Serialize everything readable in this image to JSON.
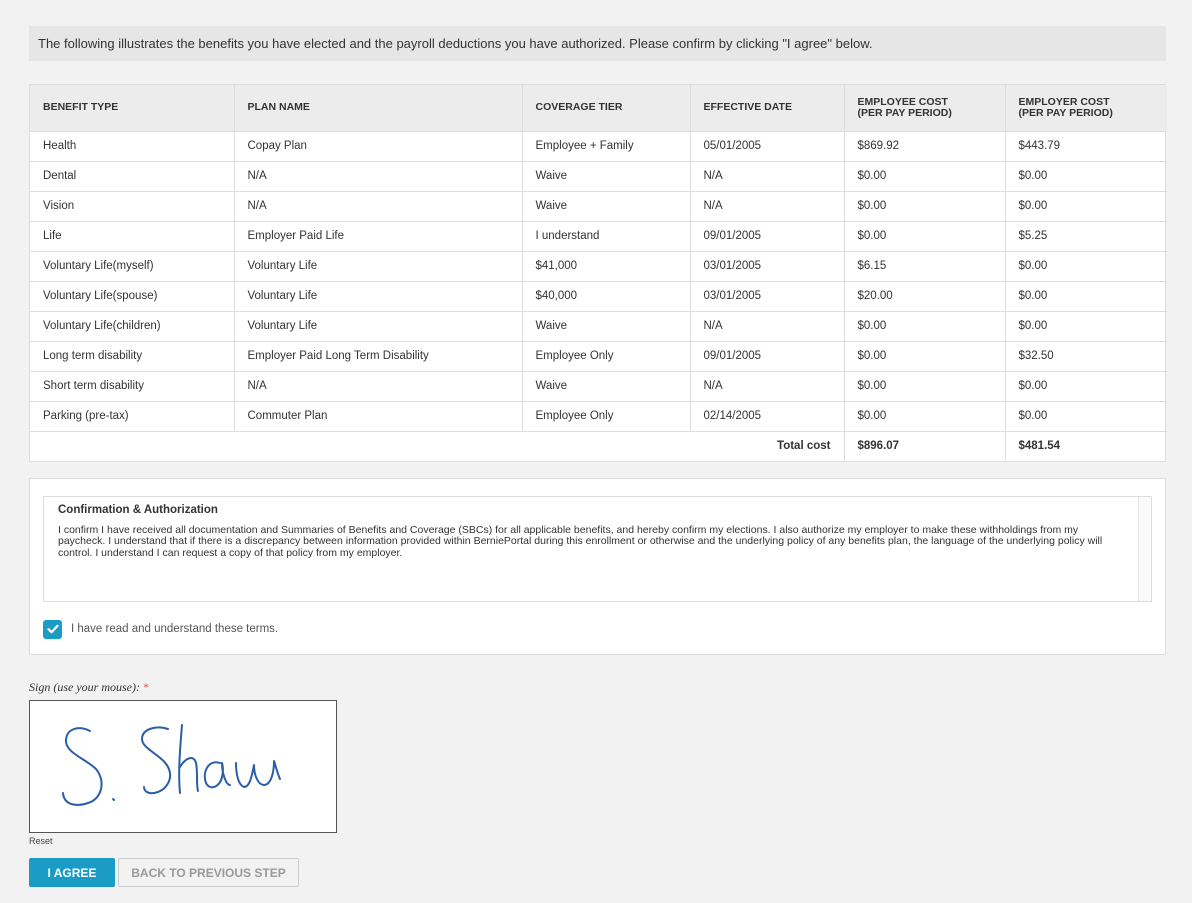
{
  "intro_text": "The following illustrates the benefits you have elected and the payroll deductions you have authorized. Please confirm by clicking \"I agree\" below.",
  "table": {
    "headers": {
      "benefit_type": "BENEFIT TYPE",
      "plan_name": "PLAN NAME",
      "coverage_tier": "COVERAGE TIER",
      "effective_date": "EFFECTIVE DATE",
      "employee_cost_line1": "EMPLOYEE COST",
      "employee_cost_line2": "(PER PAY PERIOD)",
      "employer_cost_line1": "EMPLOYER COST",
      "employer_cost_line2": "(PER PAY PERIOD)"
    },
    "rows": [
      {
        "benefit": "Health",
        "plan": "Copay Plan",
        "tier": "Employee + Family",
        "date": "05/01/2005",
        "employee_cost": "$869.92",
        "employer_cost": "$443.79"
      },
      {
        "benefit": "Dental",
        "plan": "N/A",
        "tier": "Waive",
        "date": "N/A",
        "employee_cost": "$0.00",
        "employer_cost": "$0.00"
      },
      {
        "benefit": "Vision",
        "plan": "N/A",
        "tier": "Waive",
        "date": "N/A",
        "employee_cost": "$0.00",
        "employer_cost": "$0.00"
      },
      {
        "benefit": "Life",
        "plan": "Employer Paid Life",
        "tier": "I understand",
        "date": "09/01/2005",
        "employee_cost": "$0.00",
        "employer_cost": "$5.25"
      },
      {
        "benefit": "Voluntary Life(myself)",
        "plan": "Voluntary Life",
        "tier": "$41,000",
        "date": "03/01/2005",
        "employee_cost": "$6.15",
        "employer_cost": "$0.00"
      },
      {
        "benefit": "Voluntary Life(spouse)",
        "plan": "Voluntary Life",
        "tier": "$40,000",
        "date": "03/01/2005",
        "employee_cost": "$20.00",
        "employer_cost": "$0.00"
      },
      {
        "benefit": "Voluntary Life(children)",
        "plan": "Voluntary Life",
        "tier": "Waive",
        "date": "N/A",
        "employee_cost": "$0.00",
        "employer_cost": "$0.00"
      },
      {
        "benefit": "Long term disability",
        "plan": "Employer Paid Long Term Disability",
        "tier": "Employee Only",
        "date": "09/01/2005",
        "employee_cost": "$0.00",
        "employer_cost": "$32.50"
      },
      {
        "benefit": "Short term disability",
        "plan": "N/A",
        "tier": "Waive",
        "date": "N/A",
        "employee_cost": "$0.00",
        "employer_cost": "$0.00"
      },
      {
        "benefit": "Parking (pre-tax)",
        "plan": "Commuter Plan",
        "tier": "Employee Only",
        "date": "02/14/2005",
        "employee_cost": "$0.00",
        "employer_cost": "$0.00"
      }
    ],
    "total_label": "Total cost",
    "total_employee": "$896.07",
    "total_employer": "$481.54"
  },
  "confirmation": {
    "title": "Confirmation & Authorization",
    "body": "I confirm I have received all documentation and Summaries of Benefits and Coverage (SBCs) for all applicable benefits, and hereby confirm my elections. I also authorize my employer to make these withholdings from my paycheck. I understand that if there is a discrepancy between information provided within BerniePortal during this enrollment or otherwise and the underlying policy of any benefits plan, the language of the underlying policy will control. I understand I can request a copy of that policy from my employer.",
    "checkbox_label": "I have read and understand these terms.",
    "checkbox_checked": true
  },
  "signature": {
    "label": "Sign (use your mouse):",
    "required_mark": "*",
    "signed_name": "S. Shaw",
    "reset_label": "Reset"
  },
  "buttons": {
    "agree": "I AGREE",
    "back": "BACK TO PREVIOUS STEP"
  },
  "colors": {
    "accent": "#1a9cc7",
    "ink": "#2a5fa8"
  },
  "icons": {
    "checkbox": "check-icon"
  }
}
